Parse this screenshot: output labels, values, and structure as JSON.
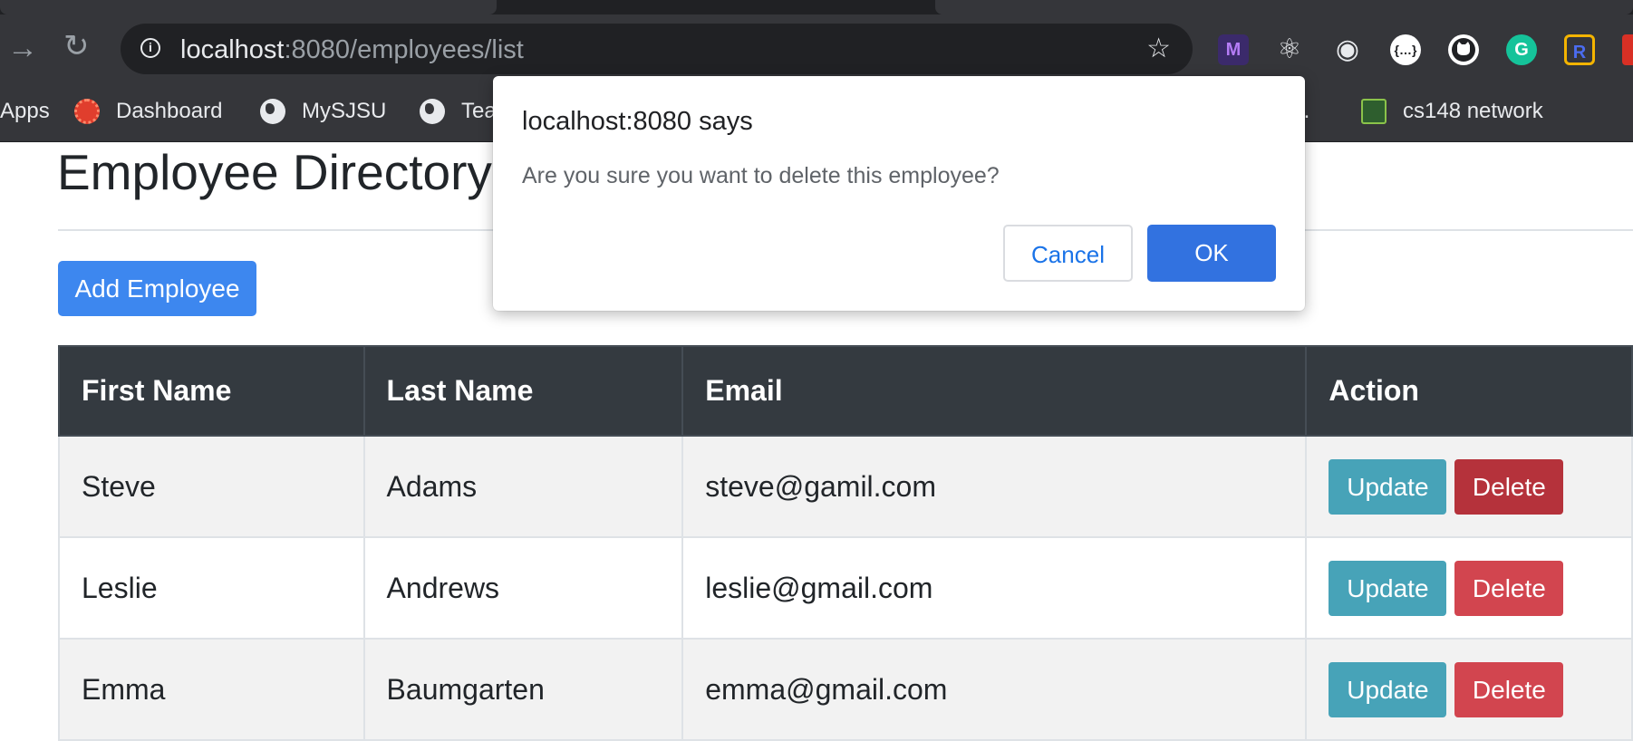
{
  "browser": {
    "url_host": "localhost",
    "url_path": ":8080/employees/list",
    "bookmarks": [
      {
        "label": "Apps"
      },
      {
        "label": "Dashboard"
      },
      {
        "label": "MySJSU"
      },
      {
        "label": "Tea"
      },
      {
        "label": "o..."
      },
      {
        "label": "cs148 network"
      }
    ],
    "extensions": [
      "M",
      "⚛",
      "◉",
      "{…}",
      "",
      "G",
      "R",
      ""
    ]
  },
  "page": {
    "title": "Employee Directory",
    "add_button": "Add Employee",
    "table": {
      "headers": [
        "First Name",
        "Last Name",
        "Email",
        "Action"
      ],
      "rows": [
        {
          "first": "Steve",
          "last": "Adams",
          "email": "steve@gamil.com",
          "update": "Update",
          "delete": "Delete"
        },
        {
          "first": "Leslie",
          "last": "Andrews",
          "email": "leslie@gmail.com",
          "update": "Update",
          "delete": "Delete"
        },
        {
          "first": "Emma",
          "last": "Baumgarten",
          "email": "emma@gmail.com",
          "update": "Update",
          "delete": "Delete"
        }
      ]
    }
  },
  "dialog": {
    "title": "localhost:8080 says",
    "message": "Are you sure you want to delete this employee?",
    "cancel": "Cancel",
    "ok": "OK"
  },
  "colors": {
    "primary": "#3d87ef",
    "update": "#47a3b8",
    "delete": "#d2454f",
    "table_header": "#343a40",
    "dialog_ok": "#3272e0"
  }
}
